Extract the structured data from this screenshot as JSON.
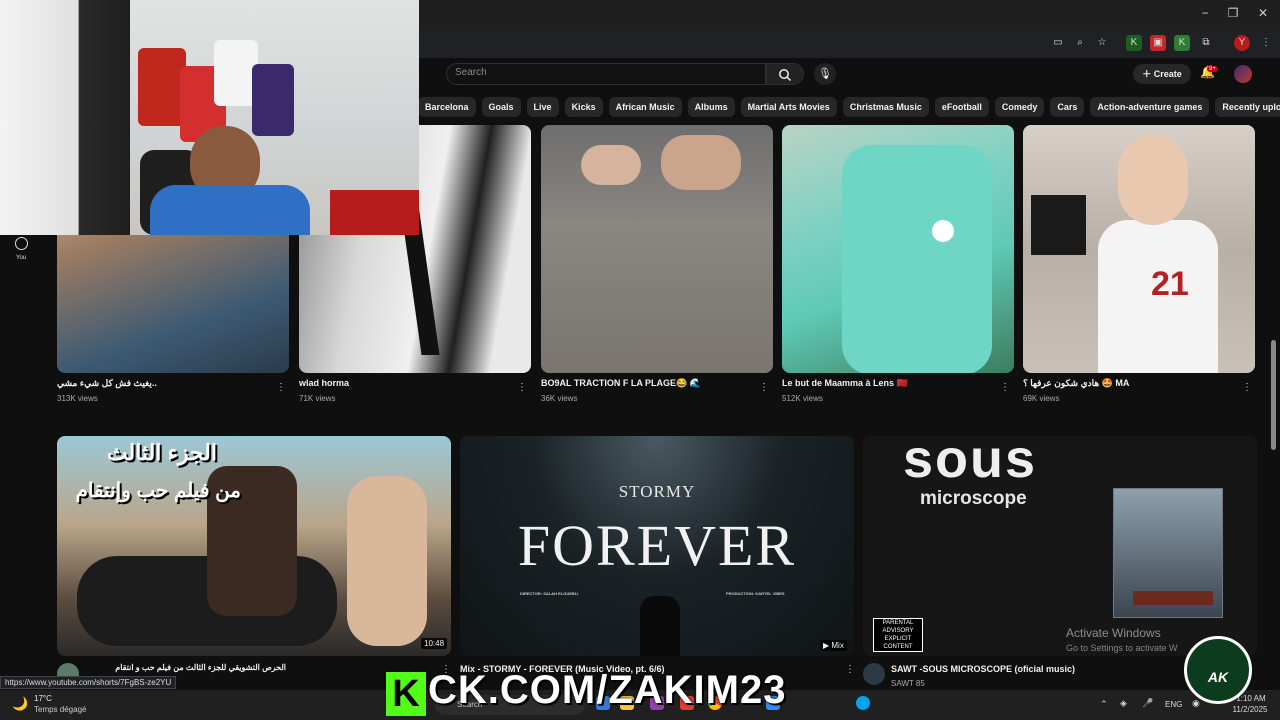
{
  "browser": {
    "window_buttons": [
      "−",
      "❐",
      "✕"
    ]
  },
  "header": {
    "search_placeholder": "Search",
    "create_label": "Create",
    "notification_count": "9+"
  },
  "chips": [
    "Barcelona",
    "Goals",
    "Live",
    "Kicks",
    "African Music",
    "Albums",
    "Martial Arts Movies",
    "Christmas Music",
    "eFootball",
    "Comedy",
    "Cars",
    "Action-adventure games",
    "Recently uploaded"
  ],
  "sidebar": {
    "you_label": "You"
  },
  "shorts": [
    {
      "title": "يغيث فش كل شيء مشي..",
      "views": "313K views"
    },
    {
      "title": "wlad horma",
      "views": "71K views"
    },
    {
      "title": "BO9AL TRACTION F LA PLAGE😂 🌊",
      "views": "36K views"
    },
    {
      "title": "Le but de Maamma à Lens 🇲🇦",
      "views": "512K views"
    },
    {
      "title": "هادي شكون عرفها ؟ 🤩 MA",
      "views": "69K views"
    }
  ],
  "thumb_text": {
    "arabic_line1": "الجزء الثالث",
    "arabic_line2": "من فيلم حب وإنتقام",
    "stormy": "STORMY",
    "forever": "FOREVER",
    "director": "DIRECTOR: SALAH ELGUEBLI",
    "production": "PRODUCTION: KARTEL VIBES",
    "sous": "sous",
    "microscope": "microscope",
    "parental": "PARENTAL ADVISORY EXPLICIT CONTENT",
    "duration": "10:48",
    "mix_badge": "Mix"
  },
  "videos": [
    {
      "title": "الحرص التشويقي للجزء الثالث من فيلم حب و انتقام",
      "meta": ""
    },
    {
      "title": "Mix - STORMY - FOREVER (Music Video, pt. 6/6)",
      "meta": ""
    },
    {
      "title": "SAWT -SOUS MICROSCOPE (oficial music)",
      "meta": "SAWT 85"
    }
  ],
  "status_url": "https://www.youtube.com/shorts/7FgBS-ze2YU",
  "watermark": {
    "activate_title": "Activate Windows",
    "activate_sub": "Go to Settings to activate W",
    "kick": "KICK.COM/ZAKIM23",
    "ak": "AK"
  },
  "taskbar": {
    "temp": "17°C",
    "weather": "Temps dégagé",
    "search_placeholder": "Search",
    "lang": "ENG",
    "time": "1:10 AM",
    "date": "11/2/2025"
  }
}
